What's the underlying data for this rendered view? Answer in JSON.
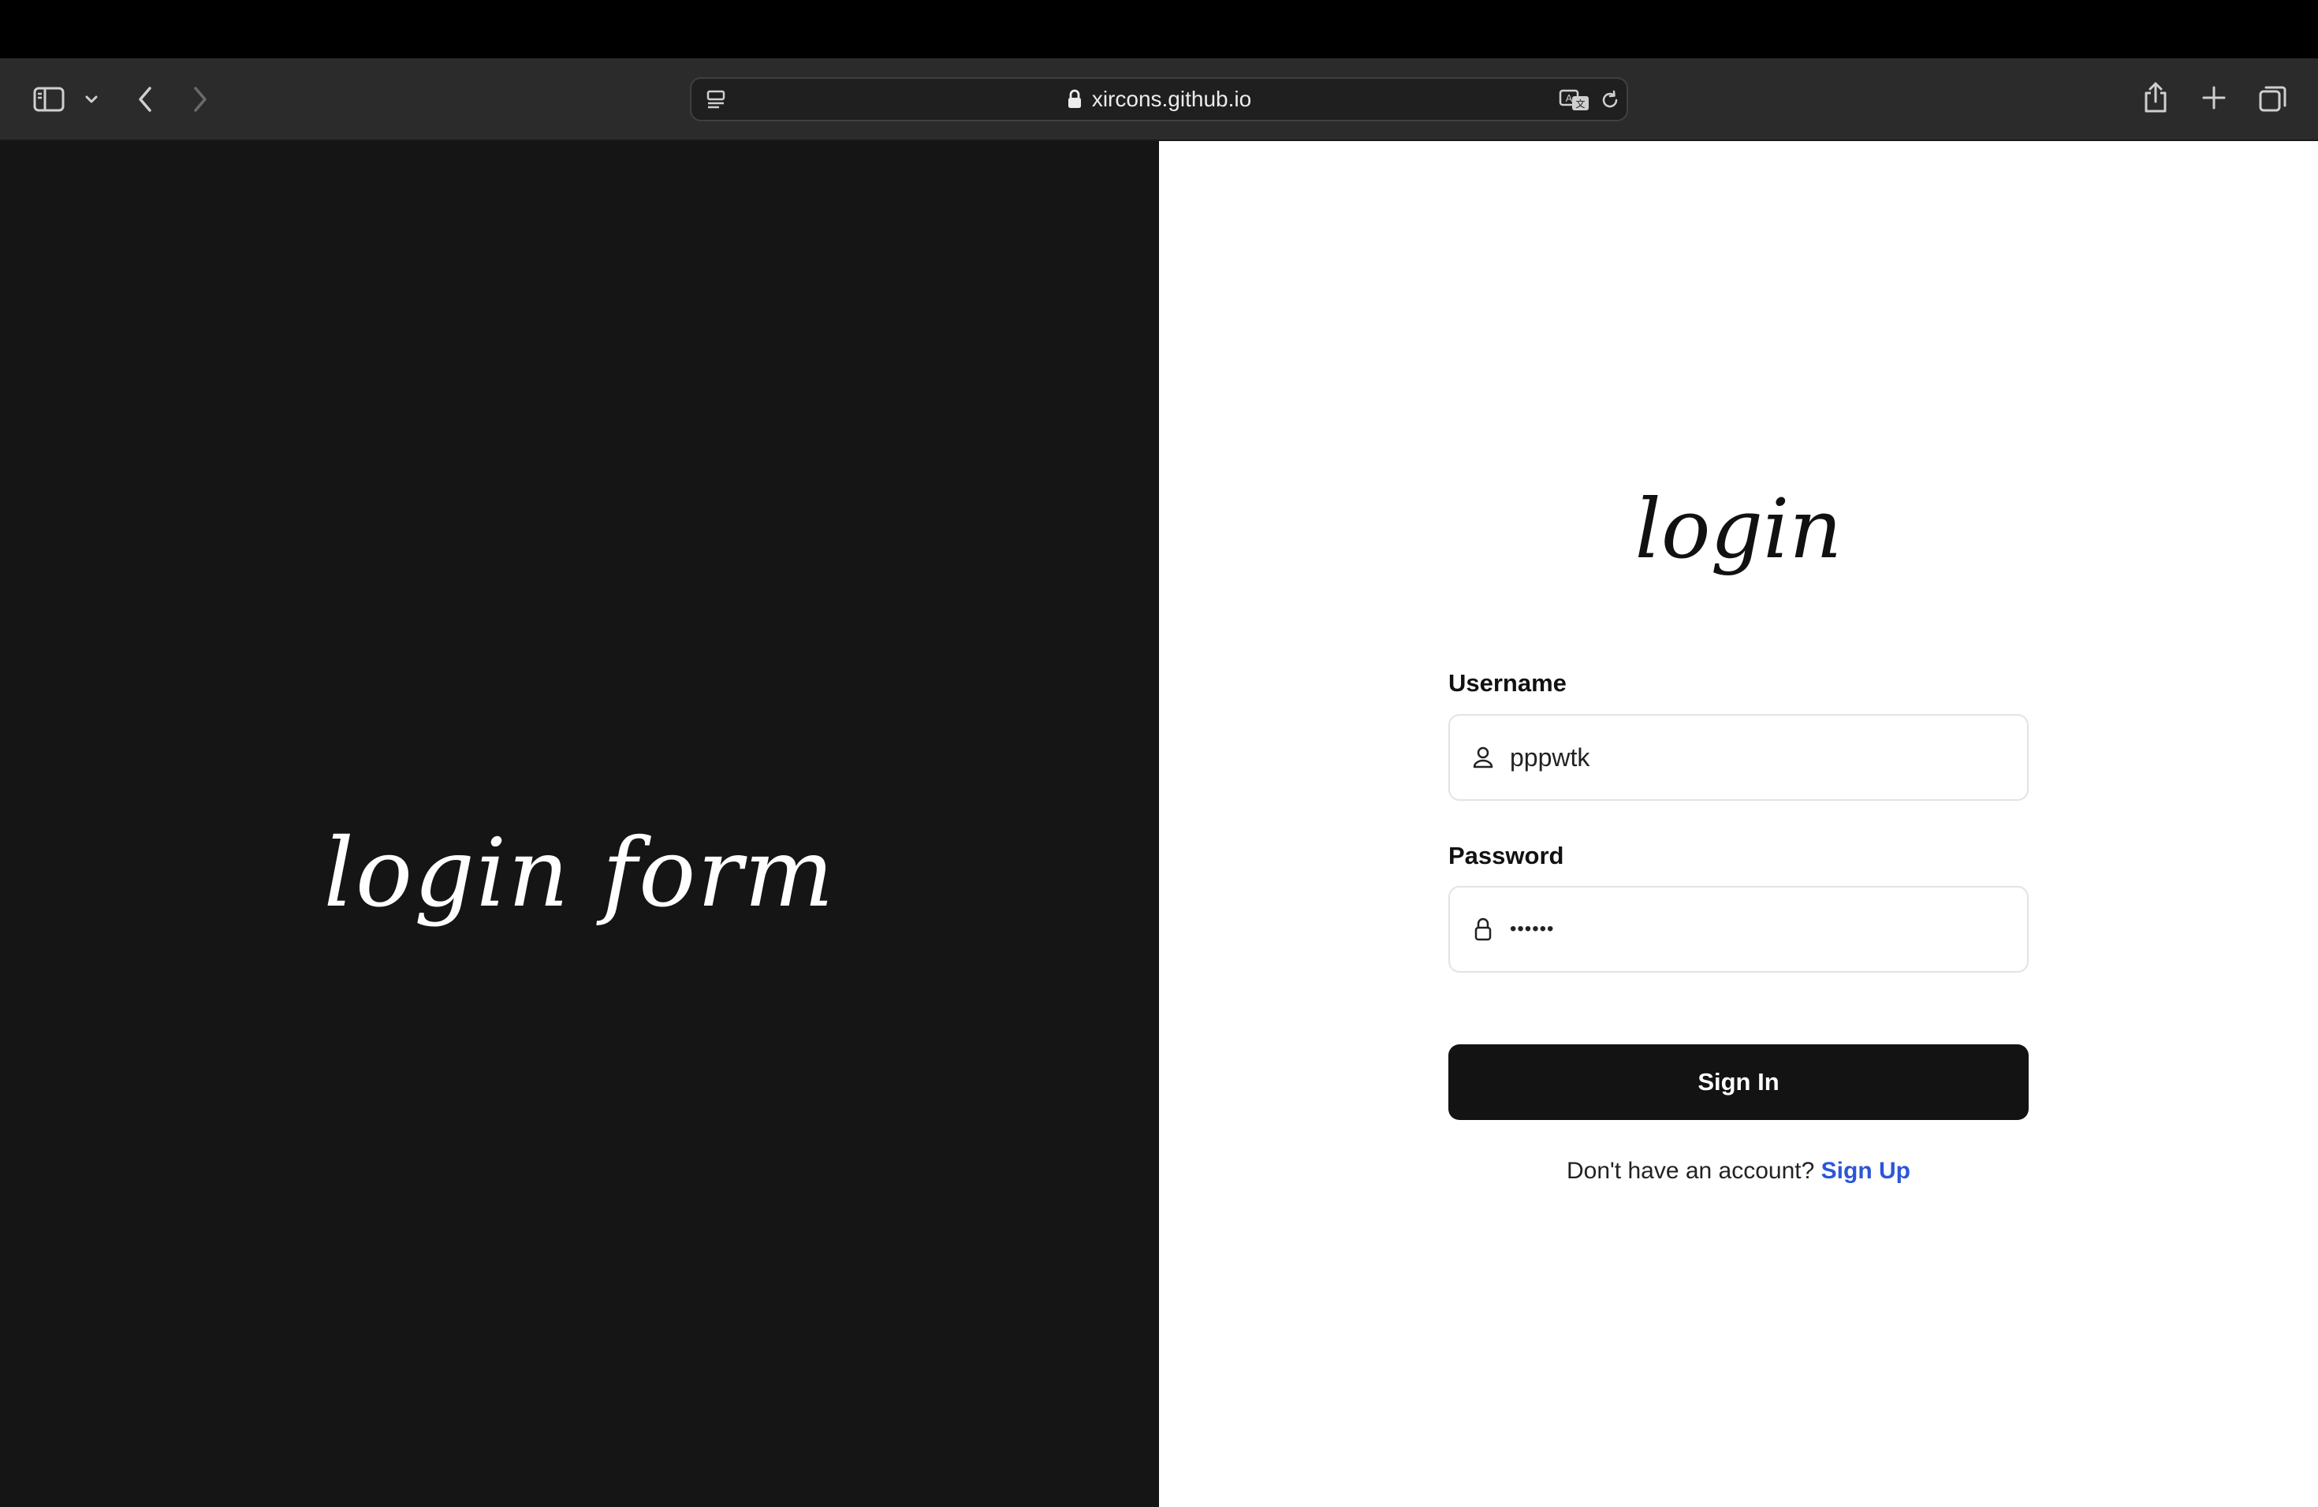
{
  "browser": {
    "url": "xircons.github.io",
    "icons": {
      "sidebar": "sidebar-icon",
      "tab_overview_chevron": "chevron-down-icon",
      "back": "chevron-left-icon",
      "forward": "chevron-right-icon",
      "reader": "reader-icon",
      "lock": "lock-icon",
      "translate": "translate-icon",
      "reload": "reload-icon",
      "share": "share-icon",
      "new_tab": "plus-icon",
      "tabs": "tabs-icon"
    }
  },
  "hero": {
    "title": "login form"
  },
  "form": {
    "title": "login",
    "username_label": "Username",
    "username_value": "pppwtk",
    "password_label": "Password",
    "password_value": "••••••",
    "submit_label": "Sign In",
    "signup_prompt": "Don't have an account?",
    "signup_link": "Sign Up"
  },
  "colors": {
    "left_panel_bg": "#151515",
    "button_bg": "#131313",
    "link": "#2b56d8"
  }
}
